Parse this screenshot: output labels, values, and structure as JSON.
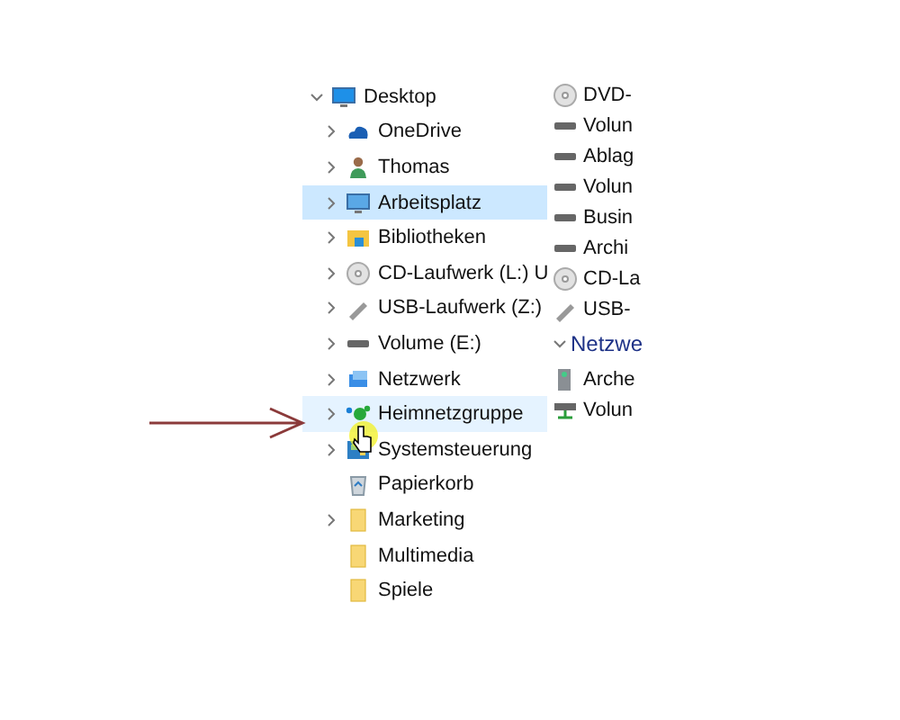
{
  "tree": [
    {
      "label": "Desktop",
      "kind": "desktop",
      "expanded": true,
      "selected": false,
      "hovered": false,
      "children": [
        {
          "label": "OneDrive",
          "kind": "cloud",
          "expandable": true,
          "selected": false,
          "hovered": false
        },
        {
          "label": "Thomas",
          "kind": "user",
          "expandable": true,
          "selected": false,
          "hovered": false
        },
        {
          "label": "Arbeitsplatz",
          "kind": "monitor",
          "expandable": true,
          "selected": true,
          "hovered": false
        },
        {
          "label": "Bibliotheken",
          "kind": "library",
          "expandable": true,
          "selected": false,
          "hovered": false
        },
        {
          "label": "CD-Laufwerk (L:) U",
          "kind": "disc",
          "expandable": true,
          "selected": false,
          "hovered": false
        },
        {
          "label": "USB-Laufwerk (Z:)",
          "kind": "usb",
          "expandable": true,
          "selected": false,
          "hovered": false
        },
        {
          "label": "Volume (E:)",
          "kind": "drive",
          "expandable": true,
          "selected": false,
          "hovered": false
        },
        {
          "label": "Netzwerk",
          "kind": "network",
          "expandable": true,
          "selected": false,
          "hovered": false
        },
        {
          "label": "Heimnetzgruppe",
          "kind": "homegroup",
          "expandable": true,
          "selected": false,
          "hovered": true
        },
        {
          "label": "Systemsteuerung",
          "kind": "control",
          "expandable": true,
          "selected": false,
          "hovered": false
        },
        {
          "label": "Papierkorb",
          "kind": "bin",
          "expandable": false,
          "selected": false,
          "hovered": false
        },
        {
          "label": "Marketing",
          "kind": "folder",
          "expandable": true,
          "selected": false,
          "hovered": false
        },
        {
          "label": "Multimedia",
          "kind": "folder",
          "expandable": false,
          "selected": false,
          "hovered": false
        },
        {
          "label": "Spiele",
          "kind": "folder",
          "expandable": false,
          "selected": false,
          "hovered": false
        }
      ]
    }
  ],
  "content": [
    {
      "kind": "disc",
      "label": "DVD-"
    },
    {
      "kind": "drive",
      "label": "Volun"
    },
    {
      "kind": "drive",
      "label": "Ablag"
    },
    {
      "kind": "drive",
      "label": "Volun"
    },
    {
      "kind": "drive",
      "label": "Busin"
    },
    {
      "kind": "drive",
      "label": "Archi"
    },
    {
      "kind": "disc",
      "label": "CD-La"
    },
    {
      "kind": "usb",
      "label": "USB-"
    },
    {
      "kind": "group",
      "label": "Netzwe",
      "expanded": true
    },
    {
      "kind": "nas",
      "label": "Arche"
    },
    {
      "kind": "netdrive",
      "label": "Volun"
    }
  ]
}
